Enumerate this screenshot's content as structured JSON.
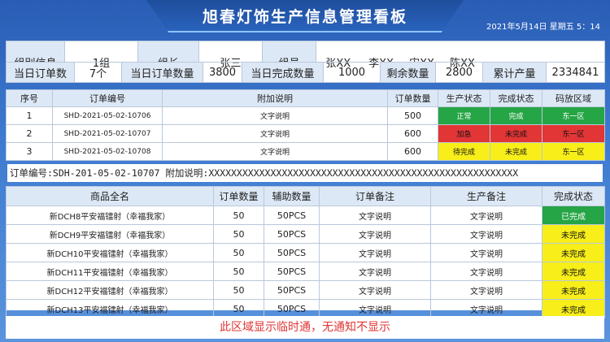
{
  "header": {
    "title": "旭春灯饰生产信息管理看板",
    "datetime": "2021年5月14日 星期五 5：14"
  },
  "info": {
    "group_label": "组别信息",
    "group_value": "1组",
    "leader_label": "组长",
    "leader_value": "张三",
    "members_label": "组员",
    "members": [
      "张XX",
      "李XX",
      "宋XX",
      "陈XX"
    ],
    "today_orders_label": "当日订单数",
    "today_orders_value": "7个",
    "today_qty_label": "当日订单数量",
    "today_qty_value": "3800",
    "today_done_label": "当日完成数量",
    "today_done_value": "1000",
    "remaining_label": "剩余数量",
    "remaining_value": "2800",
    "cumulative_label": "累计产量",
    "cumulative_value": "2334841"
  },
  "orders_table": {
    "headers": [
      "序号",
      "订单编号",
      "附加说明",
      "订单数量",
      "生产状态",
      "完成状态",
      "码放区域"
    ],
    "rows": [
      {
        "seq": "1",
        "order_no": "SHD-2021-05-02-10706",
        "note": "文字说明",
        "qty": "500",
        "prod_status": "正常",
        "prod_color": "green",
        "done_status": "完成",
        "done_color": "green",
        "area": "东一区",
        "area_color": "green"
      },
      {
        "seq": "2",
        "order_no": "SHD-2021-05-02-10707",
        "note": "文字说明",
        "qty": "600",
        "prod_status": "加急",
        "prod_color": "red",
        "done_status": "未完成",
        "done_color": "red",
        "area": "东一区",
        "area_color": "red"
      },
      {
        "seq": "3",
        "order_no": "SHD-2021-05-02-10708",
        "note": "文字说明",
        "qty": "600",
        "prod_status": "待完成",
        "prod_color": "yellow",
        "done_status": "未完成",
        "done_color": "yellow",
        "area": "东一区",
        "area_color": "yellow"
      }
    ]
  },
  "order_line": {
    "text": "订单编号:SDH-201-05-02-10707 附加说明:XXXXXXXXXXXXXXXXXXXXXXXXXXXXXXXXXXXXXXXXXXXXXXXXXXXXXXX"
  },
  "products_table": {
    "headers": [
      "商品全名",
      "订单数量",
      "辅助数量",
      "订单备注",
      "生产备注",
      "完成状态"
    ],
    "rows": [
      {
        "name": "新DCH8平安福镭射（幸福我家）",
        "qty": "50",
        "aux": "50PCS",
        "order_note": "文字说明",
        "prod_note": "文字说明",
        "status": "已完成",
        "status_color": "green"
      },
      {
        "name": "新DCH9平安福镭射（幸福我家）",
        "qty": "50",
        "aux": "50PCS",
        "order_note": "文字说明",
        "prod_note": "文字说明",
        "status": "未完成",
        "status_color": "yellow"
      },
      {
        "name": "新DCH10平安福镭射（幸福我家）",
        "qty": "50",
        "aux": "50PCS",
        "order_note": "文字说明",
        "prod_note": "文字说明",
        "status": "未完成",
        "status_color": "yellow"
      },
      {
        "name": "新DCH11平安福镭射（幸福我家）",
        "qty": "50",
        "aux": "50PCS",
        "order_note": "文字说明",
        "prod_note": "文字说明",
        "status": "未完成",
        "status_color": "yellow"
      },
      {
        "name": "新DCH12平安福镭射（幸福我家）",
        "qty": "50",
        "aux": "50PCS",
        "order_note": "文字说明",
        "prod_note": "文字说明",
        "status": "未完成",
        "status_color": "yellow"
      },
      {
        "name": "新DCH13平安福镭射（幸福我家）",
        "qty": "50",
        "aux": "50PCS",
        "order_note": "文字说明",
        "prod_note": "文字说明",
        "status": "未完成",
        "status_color": "yellow"
      }
    ]
  },
  "notice": {
    "text": "此区域显示临时通，无通知不显示"
  },
  "colors": {
    "green": "#25a545",
    "red": "#e23535",
    "yellow": "#f7ee1a",
    "background": "#3d7ad0"
  }
}
